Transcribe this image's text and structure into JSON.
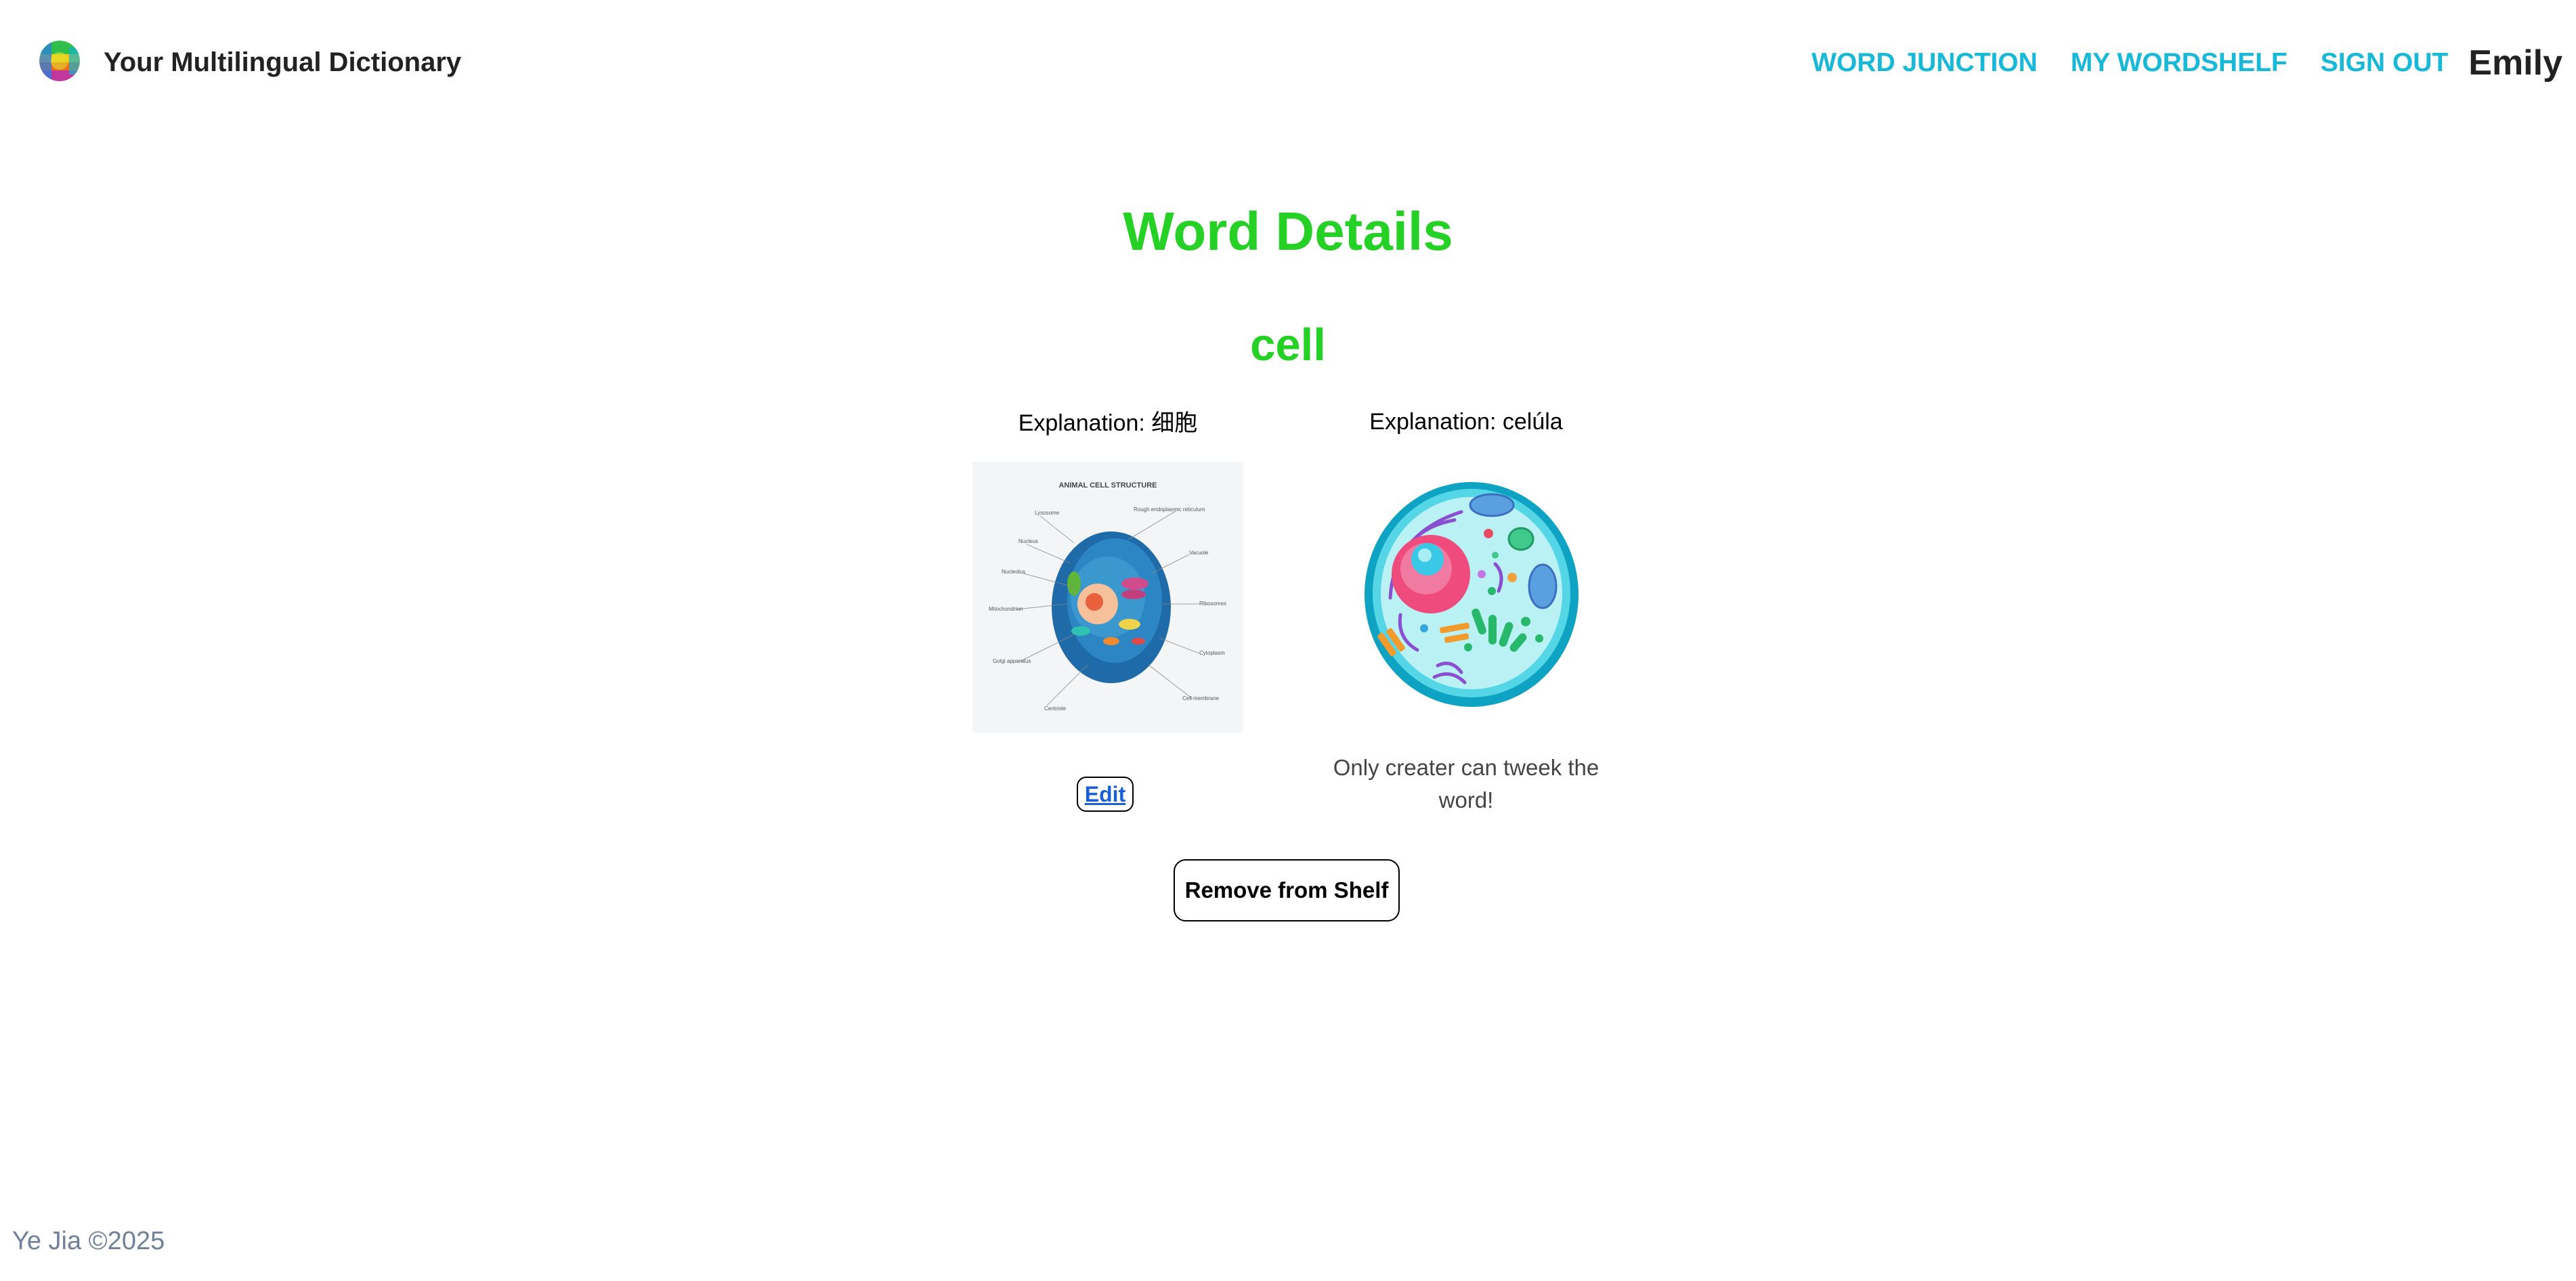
{
  "header": {
    "logo_icon": "globe-logo-icon",
    "brand": "Your Multilingual Dictionary",
    "nav": [
      {
        "label": "WORD JUNCTION"
      },
      {
        "label": "MY WORDSHELF"
      },
      {
        "label": "SIGN OUT"
      }
    ],
    "user": "Emily"
  },
  "main": {
    "title": "Word Details",
    "word": "cell",
    "cards": [
      {
        "explanation": "Explanation: 细胞",
        "image": "animal-cell-diagram-image",
        "image_text": {
          "title": "ANIMAL CELL STRUCTURE",
          "labels": [
            "Lysosome",
            "Nucleus",
            "Nucleolus",
            "Mitochondrion",
            "Golgi apparatus",
            "Centriole",
            "Rough endoplasmic reticulum",
            "Vacuole",
            "Ribosomes",
            "Cytoplasm",
            "Cell membrane"
          ]
        },
        "edit_label": "Edit"
      },
      {
        "explanation": "Explanation: celúla",
        "image": "cartoon-cell-image",
        "note": "Only creater can tweek the word!"
      }
    ],
    "remove_label": "Remove from Shelf"
  },
  "footer": {
    "text": "Ye Jia ©2025"
  },
  "colors": {
    "accent_green": "#24d124",
    "nav_cyan": "#17b8d8",
    "footer_gray": "#6f819a"
  }
}
